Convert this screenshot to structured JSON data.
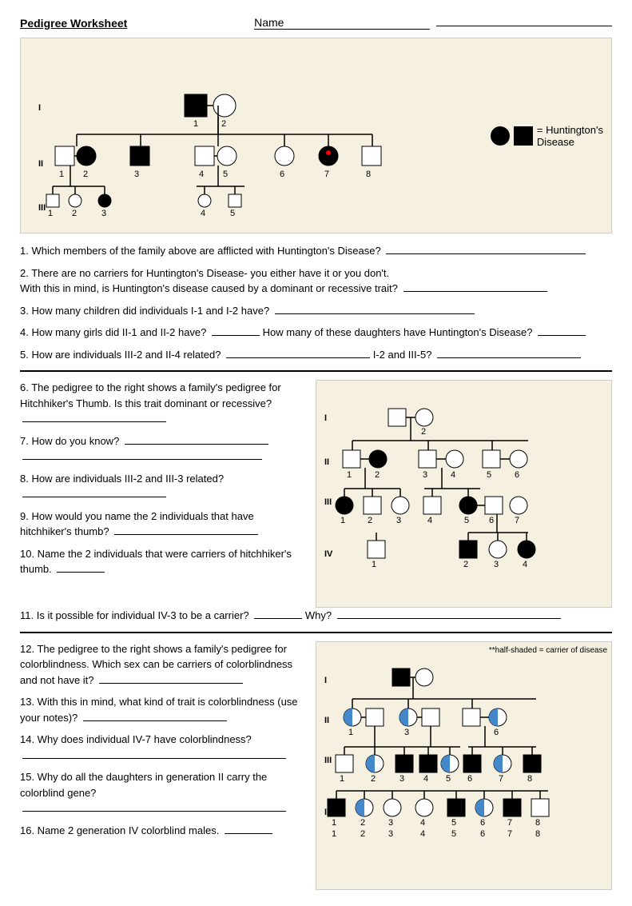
{
  "header": {
    "title": "Pedigree Worksheet",
    "name_label": "Name"
  },
  "questions": {
    "q1": "1. Which members of the family above are afflicted with Huntington's Disease?",
    "q2a": "2. There are no carriers for Huntington's Disease- you either have it or you don't.",
    "q2b": "     With this in mind, is Huntington's disease caused by a dominant or recessive trait?",
    "q3": "3. How many children did individuals I-1 and I-2 have?",
    "q4a": "4. How many girls did II-1 and II-2 have?",
    "q4b": "How many of these daughters have Huntington's Disease?",
    "q5a": "5. How are individuals III-2 and II-4 related?",
    "q5b": "I-2 and III-5?",
    "q6": "6. The pedigree to the right shows a family's pedigree for Hitchhiker's Thumb. Is this trait dominant or recessive?",
    "q7": "7. How do you know?",
    "q8": "8. How are individuals III-2 and III-3 related?",
    "q9": "9. How would you name the 2 individuals that have hitchhiker's thumb?",
    "q10": "10. Name the 2 individuals that were carriers of hitchhiker's thumb.",
    "q11": "11. Is it possible for individual IV-3 to be a carrier?",
    "q11b": "Why?",
    "q12": "12. The pedigree to the right shows a family's pedigree for colorblindness.  Which sex can be carriers of colorblindness and not have it?",
    "q13": "13. With this in mind, what kind of trait is colorblindness (use your notes)?",
    "q14": "14. Why does individual IV-7 have colorblindness?",
    "q15": "15. Why do all the daughters in generation II carry the colorblind gene?",
    "q16": "16. Name 2 generation IV colorblind males.",
    "legend1": "= Huntington's",
    "legend2": "Disease",
    "legend_half": "**half-shaded = carrier of disease"
  }
}
